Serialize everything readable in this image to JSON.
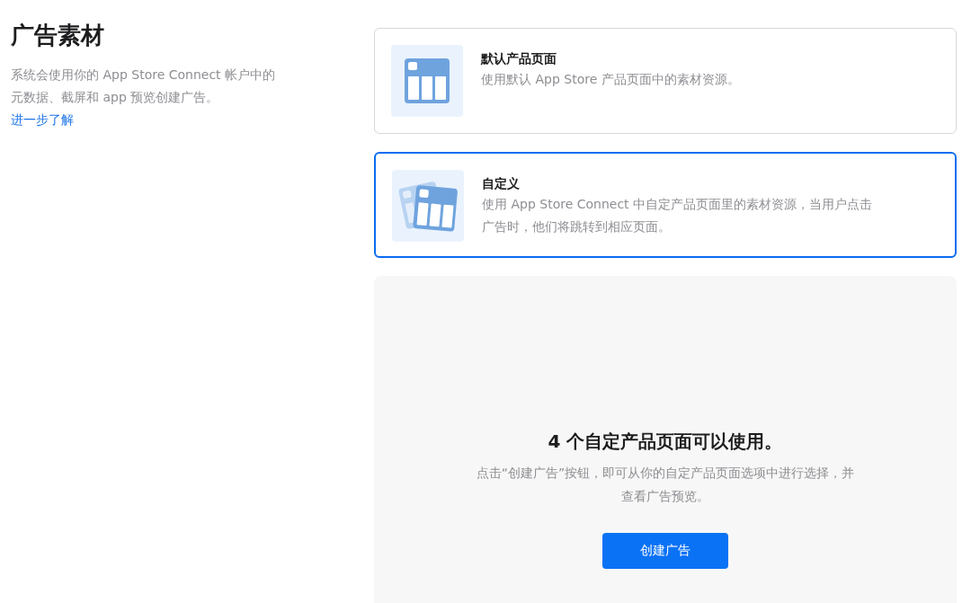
{
  "section": {
    "title": "广告素材",
    "description_lines": [
      "系统会使用你的 App Store Connect 帐户中的",
      "元数据、截屏和 app 预览创建广告。"
    ],
    "link": "进一步了解"
  },
  "options": [
    {
      "kind": "default",
      "title": "默认产品页面",
      "description_lines": [
        "使用默认 App Store 产品页面中的素材资源。"
      ],
      "selected": false
    },
    {
      "kind": "custom",
      "title": "自定义",
      "description_lines": [
        "使用 App Store Connect 中自定产品页面里的素材资源，当用户点击",
        "广告时，他们将跳转到相应页面。"
      ],
      "selected": true
    }
  ],
  "empty_state": {
    "heading": "4 个自定产品页面可以使用。",
    "text_lines": [
      "点击“创建广告”按钮，即可从你的自定产品页面选项中进行选择，并",
      "查看广告预览。"
    ],
    "button": "创建广告"
  }
}
